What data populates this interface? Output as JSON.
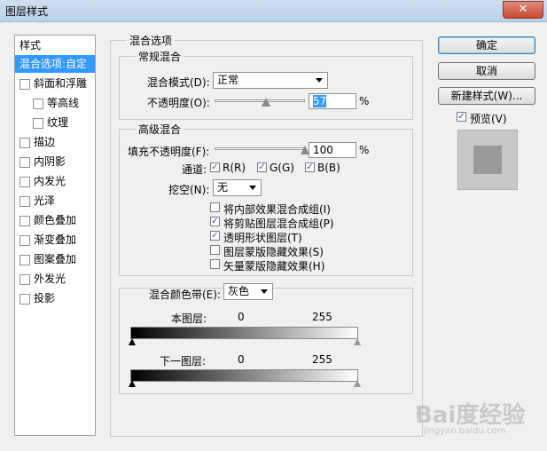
{
  "window": {
    "title": "图层样式",
    "close_symbol": "✕"
  },
  "styles_list": {
    "header": "样式",
    "items": [
      {
        "label": "混合选项:自定",
        "checkbox": false,
        "selected": true,
        "indent": 0
      },
      {
        "label": "斜面和浮雕",
        "checkbox": true,
        "checked": false,
        "indent": 0
      },
      {
        "label": "等高线",
        "checkbox": true,
        "checked": false,
        "indent": 1
      },
      {
        "label": "纹理",
        "checkbox": true,
        "checked": false,
        "indent": 1
      },
      {
        "label": "描边",
        "checkbox": true,
        "checked": false,
        "indent": 0
      },
      {
        "label": "内阴影",
        "checkbox": true,
        "checked": false,
        "indent": 0
      },
      {
        "label": "内发光",
        "checkbox": true,
        "checked": false,
        "indent": 0
      },
      {
        "label": "光泽",
        "checkbox": true,
        "checked": false,
        "indent": 0
      },
      {
        "label": "颜色叠加",
        "checkbox": true,
        "checked": false,
        "indent": 0
      },
      {
        "label": "渐变叠加",
        "checkbox": true,
        "checked": false,
        "indent": 0
      },
      {
        "label": "图案叠加",
        "checkbox": true,
        "checked": false,
        "indent": 0
      },
      {
        "label": "外发光",
        "checkbox": true,
        "checked": false,
        "indent": 0
      },
      {
        "label": "投影",
        "checkbox": true,
        "checked": false,
        "indent": 0
      }
    ]
  },
  "blend_options": {
    "title": "混合选项",
    "general": {
      "title": "常规混合",
      "blend_mode_label": "混合模式(D):",
      "blend_mode_value": "正常",
      "opacity_label": "不透明度(O):",
      "opacity_value": "57",
      "opacity_unit": "%",
      "opacity_fraction": 0.57
    },
    "advanced": {
      "title": "高级混合",
      "fill_opacity_label": "填充不透明度(F):",
      "fill_opacity_value": "100",
      "fill_opacity_unit": "%",
      "fill_fraction": 1.0,
      "channels_label": "通道:",
      "channel_r": "R(R)",
      "channel_g": "G(G)",
      "channel_b": "B(B)",
      "knockout_label": "挖空(N):",
      "knockout_value": "无",
      "options": [
        {
          "label": "将内部效果混合成组(I)",
          "checked": false
        },
        {
          "label": "将剪贴图层混合成组(P)",
          "checked": true
        },
        {
          "label": "透明形状图层(T)",
          "checked": true
        },
        {
          "label": "图层蒙版隐藏效果(S)",
          "checked": false
        },
        {
          "label": "矢量蒙版隐藏效果(H)",
          "checked": false
        }
      ]
    },
    "blend_if": {
      "label": "混合颜色带(E):",
      "value": "灰色",
      "this_layer_label": "本图层:",
      "this_layer_min": "0",
      "this_layer_max": "255",
      "underlying_label": "下一图层:",
      "underlying_min": "0",
      "underlying_max": "255"
    }
  },
  "buttons": {
    "ok": "确定",
    "cancel": "取消",
    "new_style": "新建样式(W)...",
    "preview_label": "预览(V)",
    "preview_checked": true
  },
  "watermark": {
    "text": "Bai度经验",
    "sub": "jingyan.baidu.com"
  },
  "colors": {
    "selection": "#3399ff",
    "preview_outer": "#c8c8c8",
    "preview_inner": "#9a9a9a"
  }
}
